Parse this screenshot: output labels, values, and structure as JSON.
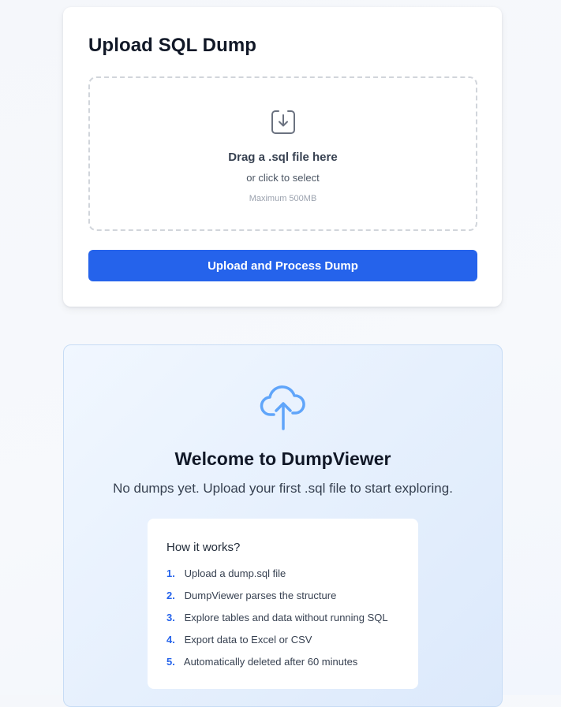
{
  "upload": {
    "title": "Upload SQL Dump",
    "dropzone": {
      "icon": "download-tray-icon",
      "title": "Drag a .sql file here",
      "subtitle": "or click to select",
      "limit": "Maximum 500MB"
    },
    "button_label": "Upload and Process Dump"
  },
  "welcome": {
    "icon": "cloud-upload-icon",
    "title": "Welcome to DumpViewer",
    "subtitle": "No dumps yet. Upload your first .sql file to start exploring.",
    "how": {
      "title": "How it works?",
      "steps": [
        {
          "num": "1.",
          "text": "Upload a dump.sql file"
        },
        {
          "num": "2.",
          "text": "DumpViewer parses the structure"
        },
        {
          "num": "3.",
          "text": "Explore tables and data without running SQL"
        },
        {
          "num": "4.",
          "text": "Export data to Excel or CSV"
        },
        {
          "num": "5.",
          "text": "Automatically deleted after 60 minutes"
        }
      ]
    }
  },
  "colors": {
    "primary": "#2563eb",
    "icon_gray": "#6b7280",
    "icon_blue": "#60a5fa",
    "text_dark": "#111827"
  }
}
